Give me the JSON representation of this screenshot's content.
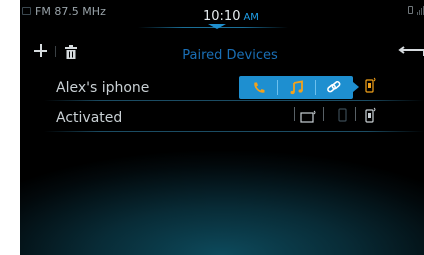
{
  "status_bar": {
    "radio_text": "FM 87.5 MHz",
    "clock_time": "10:10",
    "clock_ampm": "AM"
  },
  "header": {
    "title": "Paired Devices"
  },
  "devices": [
    {
      "name": "Alex's iphone"
    },
    {
      "name": "Activated"
    }
  ],
  "colors": {
    "accent": "#1e8fd0",
    "title": "#1a6fb6",
    "background": "#000000",
    "text": "#c9d0d4"
  },
  "icons": [
    "radio-icon",
    "phone-battery-icon",
    "signal-icon",
    "add-icon",
    "trash-icon",
    "back-arrow-icon",
    "phone-call-icon",
    "music-note-icon",
    "link-icon",
    "phone-device-icon",
    "tablet-device-icon"
  ]
}
